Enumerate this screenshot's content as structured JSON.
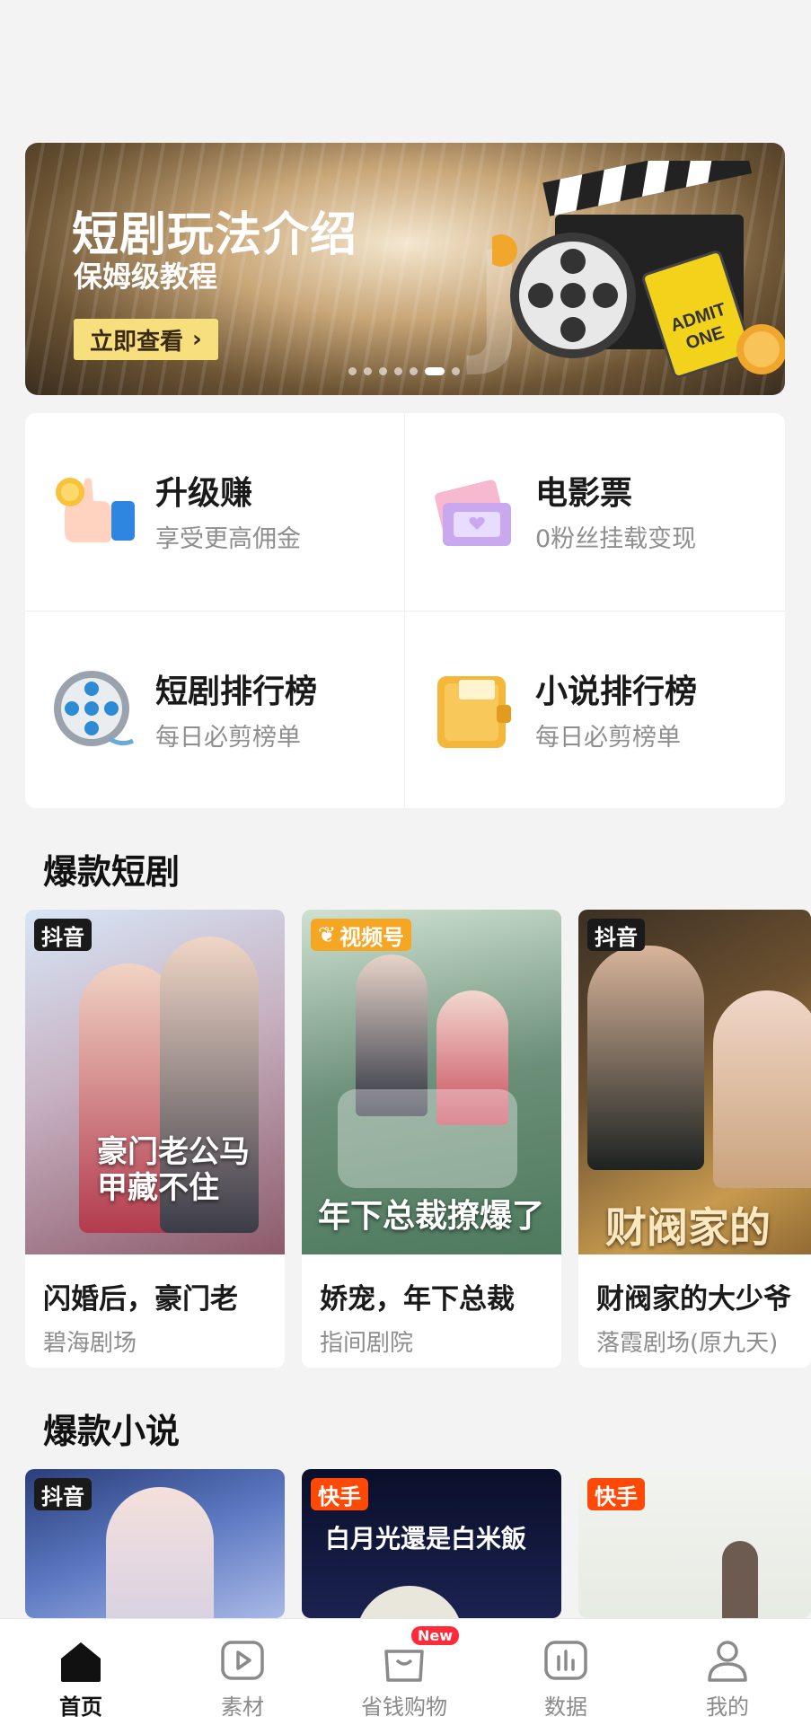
{
  "banner": {
    "title": "短剧玩法介绍",
    "subtitle": "保姆级教程",
    "cta": "立即查看",
    "page_count": 7,
    "active_page": 6
  },
  "features": [
    {
      "title": "升级赚",
      "subtitle": "享受更高佣金",
      "icon": "thumbs-up-coin-icon"
    },
    {
      "title": "电影票",
      "subtitle": "0粉丝挂载变现",
      "icon": "ticket-icon"
    },
    {
      "title": "短剧排行榜",
      "subtitle": "每日必剪榜单",
      "icon": "film-reel-icon"
    },
    {
      "title": "小说排行榜",
      "subtitle": "每日必剪榜单",
      "icon": "notebook-icon"
    }
  ],
  "drama_section": {
    "title": "爆款短剧",
    "items": [
      {
        "platform": "抖音",
        "name": "闪婚后，豪门老",
        "studio": "碧海剧场",
        "poster_text": "豪门老公马甲藏不住"
      },
      {
        "platform": "视频号",
        "name": "娇宠，年下总裁",
        "studio": "指间剧院",
        "poster_text": "年下总裁撩爆了"
      },
      {
        "platform": "抖音",
        "name": "财阀家的大少爷",
        "studio": "落霞剧场(原九天)",
        "poster_text": "财阀家的"
      }
    ]
  },
  "novel_section": {
    "title": "爆款小说",
    "items": [
      {
        "platform": "抖音"
      },
      {
        "platform": "快手",
        "poster_text": "白月光還是白米飯"
      },
      {
        "platform": "快手"
      }
    ]
  },
  "tabbar": [
    {
      "label": "首页",
      "icon": "home-icon",
      "active": true
    },
    {
      "label": "素材",
      "icon": "video-play-icon"
    },
    {
      "label": "省钱购物",
      "icon": "shopping-bag-icon",
      "badge": "New"
    },
    {
      "label": "数据",
      "icon": "bar-chart-icon"
    },
    {
      "label": "我的",
      "icon": "user-icon"
    }
  ],
  "colors": {
    "douyin_tag": "#1a1a1a",
    "shipinhao_tag": "#f5a623",
    "kuaishou_tag": "#ff4906",
    "cta_bg": "#f7df7d",
    "badge_red": "#ff2a3a"
  }
}
